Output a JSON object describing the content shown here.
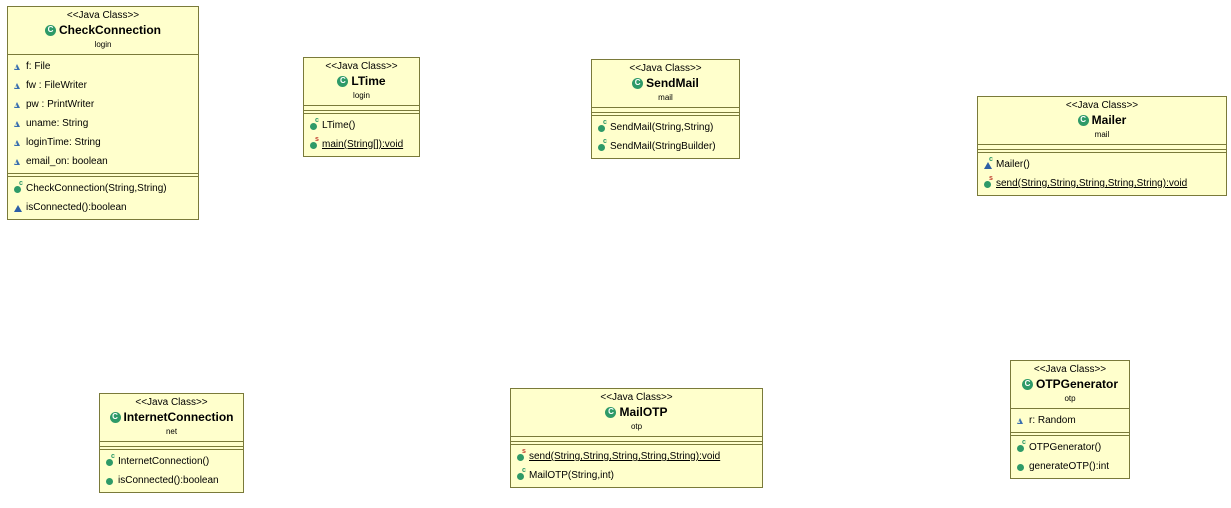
{
  "stereotype": "<<Java Class>>",
  "classes": [
    {
      "name": "CheckConnection",
      "package": "login",
      "fields": [
        {
          "vis": "package",
          "text": "f: File"
        },
        {
          "vis": "package",
          "text": "fw : FileWriter"
        },
        {
          "vis": "package",
          "text": "pw : PrintWriter"
        },
        {
          "vis": "package",
          "text": "uname: String"
        },
        {
          "vis": "package",
          "text": "loginTime: String"
        },
        {
          "vis": "package",
          "text": "email_on: boolean"
        }
      ],
      "methods": [
        {
          "vis": "public",
          "mod": "C",
          "text": "CheckConnection(String,String)"
        },
        {
          "vis": "package-method",
          "mod": "",
          "text": "isConnected():boolean"
        }
      ]
    },
    {
      "name": "LTime",
      "package": "login",
      "fields": [],
      "methods": [
        {
          "vis": "public",
          "mod": "C",
          "text": "LTime()"
        },
        {
          "vis": "public",
          "mod": "S",
          "text": "main(String[]):void",
          "static": true
        }
      ]
    },
    {
      "name": "SendMail",
      "package": "mail",
      "fields": [],
      "methods": [
        {
          "vis": "public",
          "mod": "C",
          "text": "SendMail(String,String)"
        },
        {
          "vis": "public",
          "mod": "C",
          "text": "SendMail(StringBuilder)"
        }
      ]
    },
    {
      "name": "Mailer",
      "package": "mail",
      "fields": [],
      "methods": [
        {
          "vis": "package-method",
          "mod": "C",
          "text": "Mailer()"
        },
        {
          "vis": "public",
          "mod": "S",
          "text": "send(String,String,String,String,String):void",
          "static": true
        }
      ]
    },
    {
      "name": "InternetConnection",
      "package": "net",
      "fields": [],
      "methods": [
        {
          "vis": "public",
          "mod": "C",
          "text": "InternetConnection()"
        },
        {
          "vis": "public",
          "mod": "",
          "text": "isConnected():boolean"
        }
      ]
    },
    {
      "name": "MailOTP",
      "package": "otp",
      "fields": [],
      "methods": [
        {
          "vis": "public",
          "mod": "S",
          "text": "send(String,String,String,String,String):void",
          "static": true
        },
        {
          "vis": "public",
          "mod": "C",
          "text": "MailOTP(String,int)"
        }
      ]
    },
    {
      "name": "OTPGenerator",
      "package": "otp",
      "fields": [
        {
          "vis": "package",
          "text": "r: Random"
        }
      ],
      "methods": [
        {
          "vis": "public",
          "mod": "C",
          "text": "OTPGenerator()"
        },
        {
          "vis": "public",
          "mod": "",
          "text": "generateOTP():int"
        }
      ]
    }
  ]
}
